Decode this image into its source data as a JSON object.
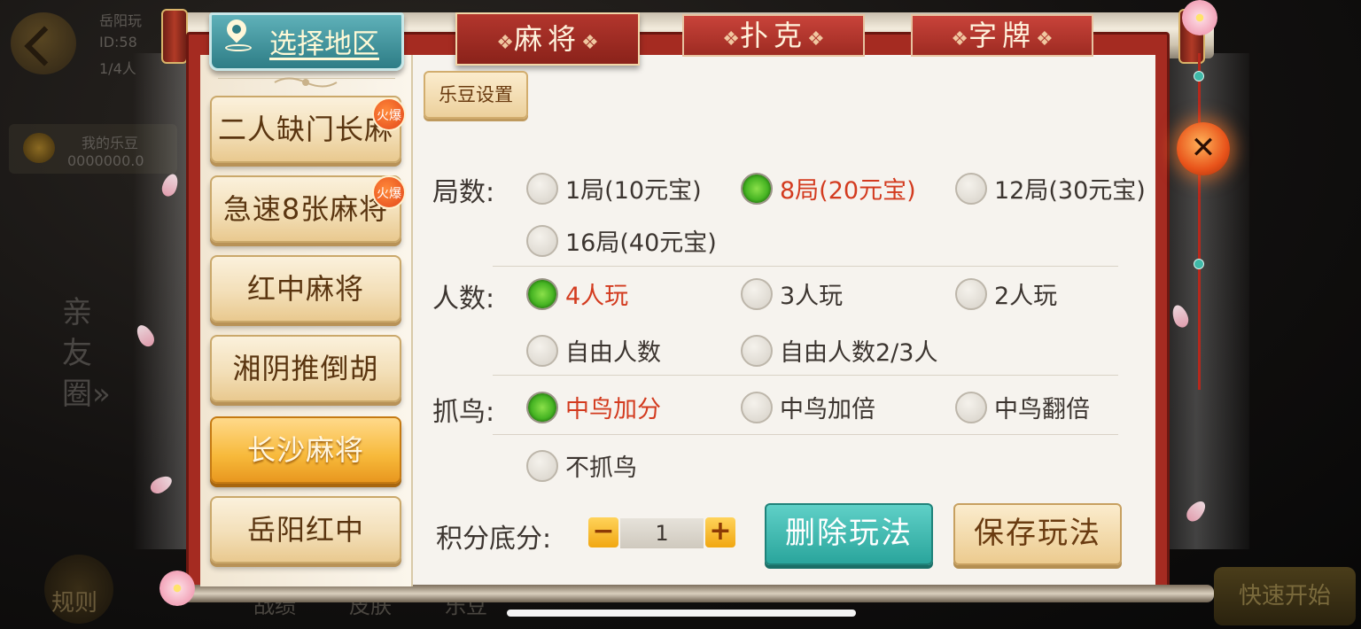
{
  "background": {
    "bg_top_text_1": "岳阳玩",
    "bg_top_text_2": "ID:58",
    "bg_top_text_3": "1/4人",
    "bg_bean_label": "我的乐豆",
    "bg_bean_value": "0000000.0",
    "bg_side_text": "亲友圈»",
    "bg_rule": "规则",
    "bg_bottom_mid_1": "战绩",
    "bg_bottom_mid_2": "皮肤",
    "bg_bottom_mid_3": "乐豆",
    "bg_quick_start": "快速开始"
  },
  "region": {
    "label": "选择地区"
  },
  "category_tabs": [
    {
      "label": "麻将",
      "active": true
    },
    {
      "label": "扑克",
      "active": false
    },
    {
      "label": "字牌",
      "active": false
    }
  ],
  "sidebar": {
    "items": [
      {
        "label": "二人缺门长麻",
        "hot": true,
        "active": false
      },
      {
        "label": "急速8张麻将",
        "hot": true,
        "active": false
      },
      {
        "label": "红中麻将",
        "hot": false,
        "active": false
      },
      {
        "label": "湘阴推倒胡",
        "hot": false,
        "active": false
      },
      {
        "label": "长沙麻将",
        "hot": false,
        "active": true
      },
      {
        "label": "岳阳红中",
        "hot": false,
        "active": false
      }
    ],
    "hot_badge": "火爆"
  },
  "bean_settings": {
    "label": "乐豆设置"
  },
  "rounds": {
    "label": "局数:",
    "options": [
      {
        "label": "1局(10元宝)",
        "selected": false
      },
      {
        "label": "8局(20元宝)",
        "selected": true
      },
      {
        "label": "12局(30元宝)",
        "selected": false
      },
      {
        "label": "16局(40元宝)",
        "selected": false
      }
    ]
  },
  "players": {
    "label": "人数:",
    "options": [
      {
        "label": "4人玩",
        "selected": true
      },
      {
        "label": "3人玩",
        "selected": false
      },
      {
        "label": "2人玩",
        "selected": false
      },
      {
        "label": "自由人数",
        "selected": false
      },
      {
        "label": "自由人数2/3人",
        "selected": false
      }
    ]
  },
  "birds": {
    "label": "抓鸟:",
    "options": [
      {
        "label": "中鸟加分",
        "selected": true
      },
      {
        "label": "中鸟加倍",
        "selected": false
      },
      {
        "label": "中鸟翻倍",
        "selected": false
      },
      {
        "label": "不抓鸟",
        "selected": false
      }
    ]
  },
  "score": {
    "label": "积分底分:",
    "minus": "−",
    "value": "1",
    "plus": "+"
  },
  "actions": {
    "delete_label": "删除玩法",
    "save_label": "保存玩法"
  },
  "close": {
    "label": "✕"
  },
  "colors": {
    "selected_text": "#d33b1f",
    "panel_red": "#a52b21",
    "teal_button": "#2aa59c",
    "active_item": "#f7b93a"
  }
}
